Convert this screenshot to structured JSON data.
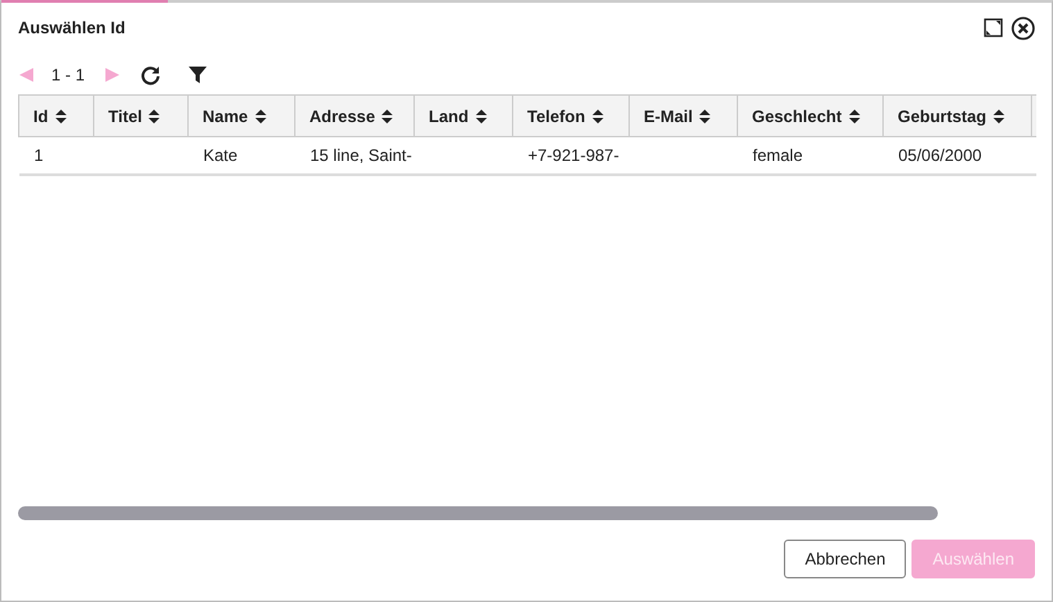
{
  "window": {
    "title": "Auswählen Id"
  },
  "pager": {
    "range": "1 - 1",
    "prev_disabled": true,
    "next_disabled": true
  },
  "table": {
    "columns": [
      {
        "label": "Id"
      },
      {
        "label": "Titel"
      },
      {
        "label": "Name"
      },
      {
        "label": "Adresse"
      },
      {
        "label": "Land"
      },
      {
        "label": "Telefon"
      },
      {
        "label": "E-Mail"
      },
      {
        "label": "Geschlecht"
      },
      {
        "label": "Geburtstag"
      }
    ],
    "rows": [
      {
        "cells": [
          "1",
          "",
          "Kate",
          "15 line, Saint-",
          "",
          "+7-921-987-",
          "",
          "female",
          "05/06/2000"
        ]
      }
    ]
  },
  "buttons": [
    {
      "label": "Abbrechen",
      "kind": "secondary",
      "disabled": false
    },
    {
      "label": "Auswählen",
      "kind": "primary",
      "disabled": true
    }
  ]
}
